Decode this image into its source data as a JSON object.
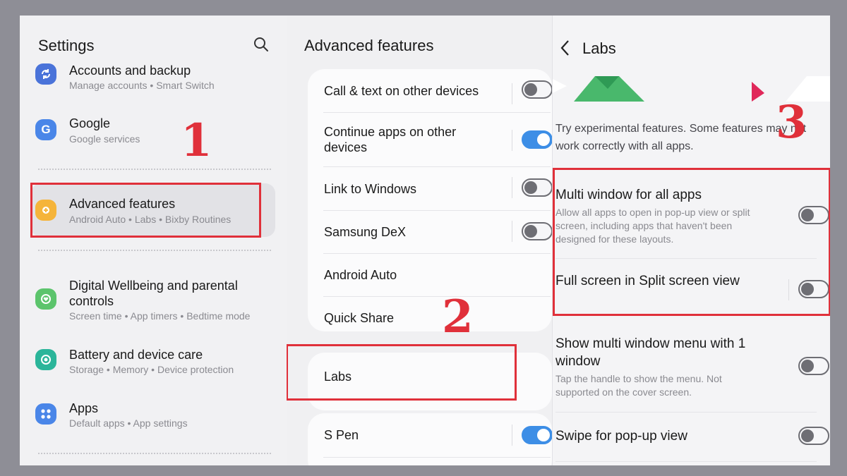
{
  "settings": {
    "title": "Settings",
    "items": [
      {
        "label": "Accounts and backup",
        "sub": "Manage accounts  •  Smart Switch",
        "icon": "sync-icon",
        "color": "#4a73d9"
      },
      {
        "label": "Google",
        "sub": "Google services",
        "icon": "google-g-icon",
        "color": "#4a86e8"
      },
      {
        "label": "Advanced features",
        "sub": "Android Auto  •  Labs  •  Bixby Routines",
        "icon": "gear-plus-icon",
        "color": "#f5b43a"
      },
      {
        "label": "Digital Wellbeing and parental controls",
        "sub": "Screen time  •  App timers  •  Bedtime mode",
        "icon": "wellbeing-icon",
        "color": "#5cc46c"
      },
      {
        "label": "Battery and device care",
        "sub": "Storage  •  Memory  •  Device protection",
        "icon": "device-care-icon",
        "color": "#2bb59a"
      },
      {
        "label": "Apps",
        "sub": "Default apps  •  App settings",
        "icon": "apps-grid-icon",
        "color": "#4a86e8"
      }
    ]
  },
  "advanced": {
    "title": "Advanced features",
    "items": [
      {
        "label": "Call & text on other devices",
        "toggle": false
      },
      {
        "label": "Continue apps on other devices",
        "toggle": true
      },
      {
        "label": "Link to Windows",
        "toggle": false
      },
      {
        "label": "Samsung DeX",
        "toggle": false
      },
      {
        "label": "Android Auto"
      },
      {
        "label": "Quick Share"
      },
      {
        "label": "Labs"
      },
      {
        "label": "S Pen",
        "toggle": true
      }
    ]
  },
  "labs": {
    "title": "Labs",
    "intro": "Try experimental features. Some features may not work correctly with all apps.",
    "items": [
      {
        "label": "Multi window for all apps",
        "sub": "Allow all apps to open in pop-up view or split screen, including apps that haven't been designed for these layouts.",
        "toggle": false
      },
      {
        "label": "Full screen in Split screen view",
        "toggle": false
      },
      {
        "label": "Show multi window menu with 1 window",
        "sub": "Tap the handle to show the menu. Not supported on the cover screen.",
        "toggle": false
      },
      {
        "label": "Swipe for pop-up view",
        "toggle": false
      }
    ]
  },
  "annotations": {
    "step1": "1",
    "step2": "2",
    "step3": "3",
    "color": "#e0303a"
  }
}
